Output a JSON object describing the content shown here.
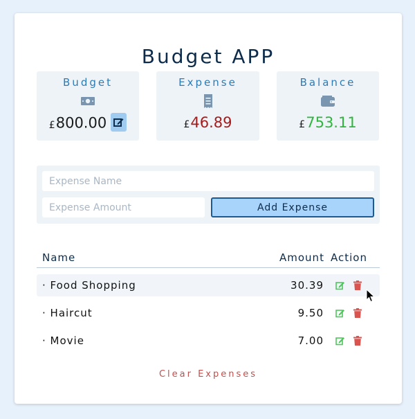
{
  "app": {
    "title": "Budget APP"
  },
  "stats": {
    "budget": {
      "label": "Budget",
      "currency": "£",
      "value": "800.00",
      "icon": "money-bill-icon"
    },
    "expense": {
      "label": "Expense",
      "currency": "£",
      "value": "46.89",
      "icon": "receipt-icon",
      "color": "#a61b1b"
    },
    "balance": {
      "label": "Balance",
      "currency": "£",
      "value": "753.11",
      "icon": "wallet-icon",
      "color": "#2fb53d"
    }
  },
  "form": {
    "name_placeholder": "Expense Name",
    "amount_placeholder": "Expense Amount",
    "name_value": "",
    "amount_value": "",
    "add_label": "Add Expense"
  },
  "table": {
    "headers": {
      "name": "Name",
      "amount": "Amount",
      "action": "Action"
    },
    "rows": [
      {
        "name": "· Food Shopping",
        "amount": "30.39"
      },
      {
        "name": "· Haircut",
        "amount": "9.50"
      },
      {
        "name": "· Movie",
        "amount": "7.00"
      }
    ]
  },
  "clear_label": "Clear Expenses",
  "colors": {
    "accent": "#2c7bb6",
    "edit_icon": "#4cc85a",
    "delete_icon": "#d9534f"
  }
}
